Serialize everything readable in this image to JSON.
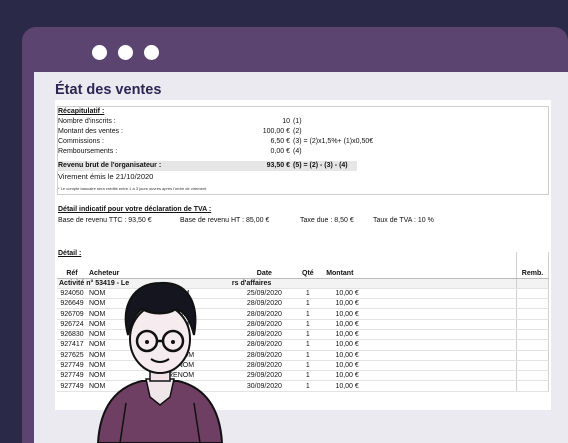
{
  "report": {
    "title": "État des ventes",
    "recap_title": "Récapitulatif :",
    "recap": [
      {
        "label": "Nombre d'inscrits :",
        "value": "10",
        "note": "(1)"
      },
      {
        "label": "Montant des ventes :",
        "value": "100,00 €",
        "note": "(2)"
      },
      {
        "label": "Commissions :",
        "value": "6,50 €",
        "note": "(3) = (2)x1,5%+ (1)x0,50€"
      },
      {
        "label": "Remboursements :",
        "value": "0,00 €",
        "note": "(4)"
      },
      {
        "label": "Revenu brut de l'organisateur :",
        "value": "93,50 €",
        "note": "(5) = (2) - (3) - (4)"
      }
    ],
    "transfer": "Virement émis le 21/10/2020",
    "transfer_note": "* Le compte bancaire sera crédité entre 1 à 3 jours ouvrés après l'ordre de virement",
    "tva_title": "Détail indicatif pour votre déclaration de TVA :",
    "tva": {
      "ttc": "Base de revenu TTC : 93,50 €",
      "ht": "Base de revenu HT : 85,00 €",
      "due": "Taxe due : 8,50 €",
      "rate": "Taux de TVA : 10 %"
    },
    "detail_title": "Détail :",
    "columns": {
      "ref": "Réf",
      "buyer": "Acheteur",
      "date": "Date",
      "qty": "Qté",
      "amount": "Montant",
      "remb": "Remb."
    },
    "activity": "Activité n° 53419 - Le",
    "activity_tail": "rs d'affaires",
    "rows": [
      {
        "ref": "924050",
        "nom": "NOM",
        "prenom": "RENOM",
        "date": "25/09/2020",
        "qty": "1",
        "amount": "10,00 €"
      },
      {
        "ref": "926649",
        "nom": "NOM",
        "prenom": "RENOM",
        "date": "28/09/2020",
        "qty": "1",
        "amount": "10,00 €"
      },
      {
        "ref": "926709",
        "nom": "NOM",
        "prenom": "RENOM",
        "date": "28/09/2020",
        "qty": "1",
        "amount": "10,00 €"
      },
      {
        "ref": "926724",
        "nom": "NOM",
        "prenom": "RENOM",
        "date": "28/09/2020",
        "qty": "1",
        "amount": "10,00 €"
      },
      {
        "ref": "926830",
        "nom": "NOM",
        "prenom": "RENOM",
        "date": "28/09/2020",
        "qty": "1",
        "amount": "10,00 €"
      },
      {
        "ref": "927417",
        "nom": "NOM",
        "prenom": "RENOM",
        "date": "28/09/2020",
        "qty": "1",
        "amount": "10,00 €"
      },
      {
        "ref": "927625",
        "nom": "NOM",
        "prenom": "PRENOM",
        "date": "28/09/2020",
        "qty": "1",
        "amount": "10,00 €"
      },
      {
        "ref": "927749",
        "nom": "NOM",
        "prenom": "PRENOM",
        "date": "28/09/2020",
        "qty": "1",
        "amount": "10,00 €"
      },
      {
        "ref": "927749",
        "nom": "NOM",
        "prenom": "PRENOM",
        "date": "29/09/2020",
        "qty": "1",
        "amount": "10,00 €"
      },
      {
        "ref": "927749",
        "nom": "NOM",
        "prenom": "",
        "date": "30/09/2020",
        "qty": "1",
        "amount": "10,00 €"
      }
    ]
  },
  "colors": {
    "background": "#2a2a48",
    "window": "#5b4470",
    "title": "#2d2552"
  },
  "icons": [
    "window-dot-icon",
    "person-illustration"
  ]
}
